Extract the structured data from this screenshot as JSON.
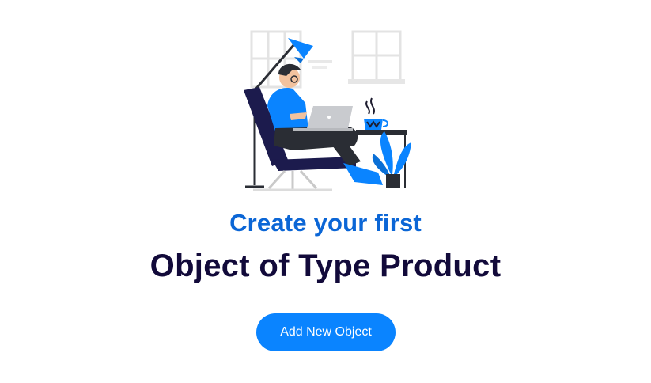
{
  "empty_state": {
    "illustration_icon": "person-working-on-laptop-illustration",
    "subtitle": "Create your first",
    "title": "Object of Type Product",
    "button_label": "Add New Object"
  },
  "colors": {
    "accent": "#0a84ff",
    "subtitle": "#0b66d6",
    "title": "#120a3a"
  }
}
